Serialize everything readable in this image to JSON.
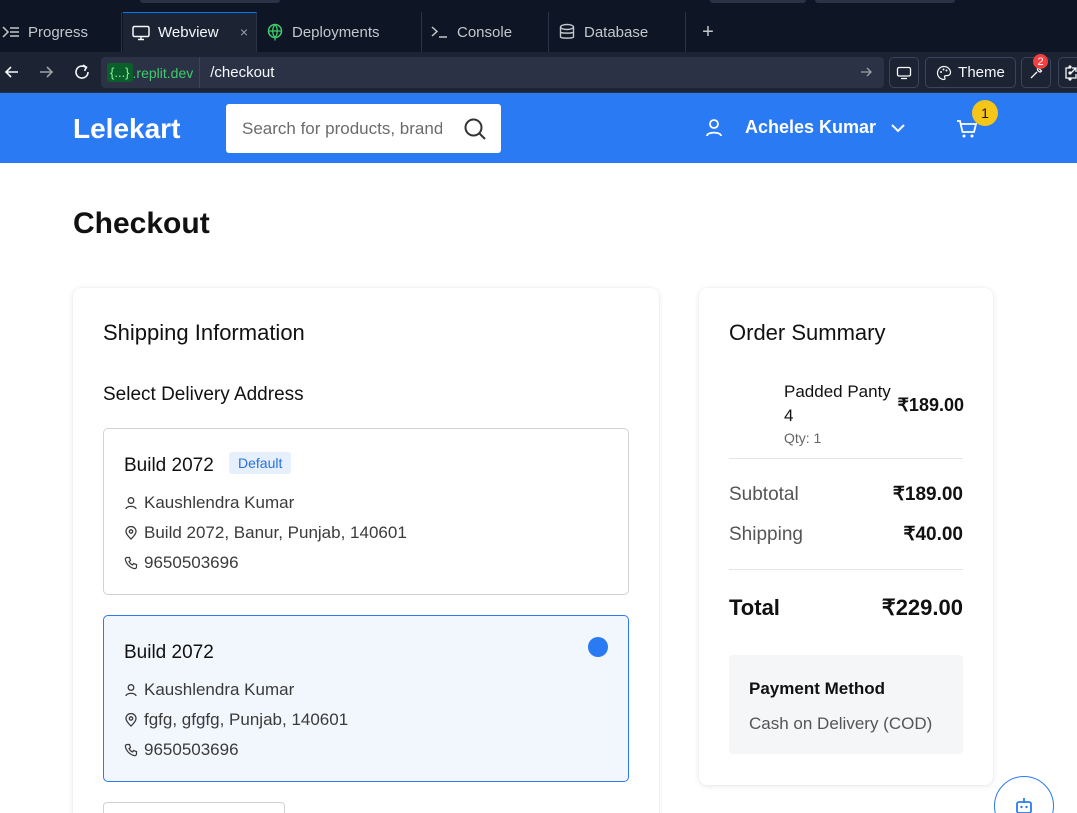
{
  "ide": {
    "tabs": [
      {
        "label": "Progress",
        "icon": "progress-icon"
      },
      {
        "label": "Webview",
        "icon": "monitor-icon",
        "active": true
      },
      {
        "label": "Deployments",
        "icon": "globe-icon"
      },
      {
        "label": "Console",
        "icon": "terminal-icon"
      },
      {
        "label": "Database",
        "icon": "database-icon"
      }
    ],
    "close_glyph": "×",
    "add_glyph": "+"
  },
  "urlbar": {
    "domain_braces": "{...}",
    "domain_suffix": ".replit.dev",
    "path": "/checkout",
    "theme_label": "Theme",
    "notifications": "2"
  },
  "site": {
    "logo": "Lelekart",
    "search_placeholder": "Search for products, brands and more",
    "user_name": "Acheles Kumar",
    "cart_count": "1",
    "accent_color": "#2a7af3"
  },
  "checkout": {
    "title": "Checkout",
    "shipping": {
      "heading": "Shipping Information",
      "select_label": "Select Delivery Address",
      "addresses": [
        {
          "title": "Build 2072",
          "badge": "Default",
          "name": "Kaushlendra Kumar",
          "address": "Build 2072, Banur, Punjab, 140601",
          "phone": "9650503696",
          "selected": false
        },
        {
          "title": "Build 2072",
          "name": "Kaushlendra Kumar",
          "address": "fgfg, gfgfg, Punjab, 140601",
          "phone": "9650503696",
          "selected": true
        }
      ]
    },
    "summary": {
      "heading": "Order Summary",
      "item_name_line1": "Padded Panty",
      "item_name_line2": "4",
      "item_qty": "Qty: 1",
      "item_price": "₹189.00",
      "subtotal_label": "Subtotal",
      "subtotal_value": "₹189.00",
      "shipping_label": "Shipping",
      "shipping_value": "₹40.00",
      "total_label": "Total",
      "total_value": "₹229.00",
      "payment_heading": "Payment Method",
      "payment_value": "Cash on Delivery (COD)"
    }
  }
}
